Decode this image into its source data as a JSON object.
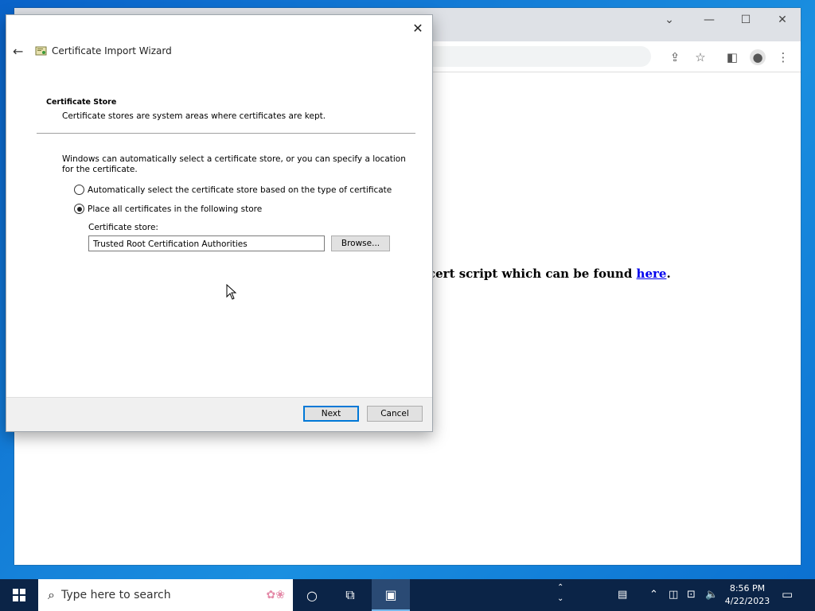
{
  "browser": {
    "page_text": "cert script which can be found ",
    "link_text": "here",
    "trailing": "."
  },
  "dialog": {
    "title": "Certificate Import Wizard",
    "section_title": "Certificate Store",
    "section_desc": "Certificate stores are system areas where certificates are kept.",
    "info": "Windows can automatically select a certificate store, or you can specify a location for the certificate.",
    "options": [
      {
        "label": "Automatically select the certificate store based on the type of certificate",
        "selected": false
      },
      {
        "label": "Place all certificates in the following store",
        "selected": true
      }
    ],
    "store_label": "Certificate store:",
    "store_value": "Trusted Root Certification Authorities",
    "browse_label": "Browse...",
    "next_label": "Next",
    "cancel_label": "Cancel"
  },
  "taskbar": {
    "search_placeholder": "Type here to search",
    "time": "8:56 PM",
    "date": "4/22/2023"
  },
  "colors": {
    "accent": "#0078d7",
    "taskbar": "#0b2447"
  }
}
